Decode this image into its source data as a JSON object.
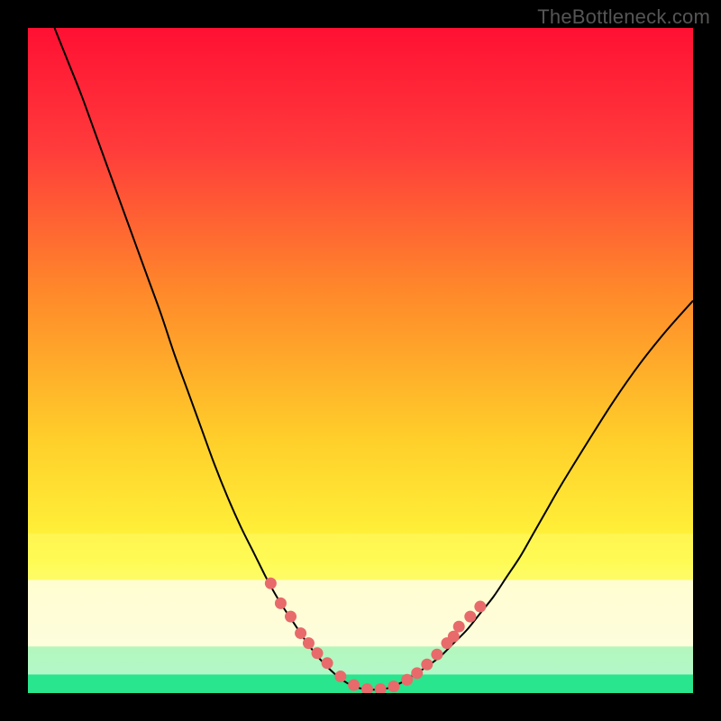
{
  "watermark": "TheBottleneck.com",
  "chart_data": {
    "type": "line",
    "title": "",
    "xlabel": "",
    "ylabel": "",
    "xlim": [
      0,
      100
    ],
    "ylim": [
      0,
      100
    ],
    "grid": false,
    "series": [
      {
        "name": "curve",
        "x": [
          4,
          6,
          8,
          10,
          12,
          14,
          16,
          18,
          20,
          22,
          24,
          26,
          28,
          30,
          32,
          34,
          36,
          38,
          40,
          42,
          44,
          46,
          48,
          50,
          52,
          54,
          56,
          58,
          60,
          62,
          64,
          66,
          68,
          70,
          72,
          74,
          76,
          78,
          80,
          84,
          88,
          92,
          96,
          100
        ],
        "y": [
          100,
          95,
          90,
          84.5,
          79,
          73.5,
          68,
          62.5,
          57,
          51,
          45.5,
          40,
          34.5,
          29.5,
          25,
          21,
          17,
          13.5,
          10.5,
          7.5,
          5,
          3,
          1.5,
          0.7,
          0.5,
          0.7,
          1.5,
          2.7,
          4,
          5.5,
          7.5,
          9.5,
          12,
          14.5,
          17.5,
          20.5,
          24,
          27.5,
          31,
          37.5,
          43.8,
          49.5,
          54.5,
          59
        ]
      }
    ],
    "markers": {
      "name": "dots",
      "color": "#e86a6a",
      "x": [
        36.5,
        38,
        39.5,
        41,
        42.2,
        43.5,
        45,
        47,
        49,
        51,
        53,
        55,
        57,
        58.5,
        60,
        61.5,
        63,
        64,
        64.8,
        66.5,
        68
      ],
      "y": [
        16.5,
        13.5,
        11.5,
        9,
        7.5,
        6,
        4.5,
        2.5,
        1.2,
        0.6,
        0.6,
        1,
        2,
        3,
        4.3,
        5.8,
        7.5,
        8.5,
        10,
        11.5,
        13
      ]
    },
    "bands": [
      {
        "name": "yellow-wash",
        "y0": 17,
        "y1": 24,
        "color": "#feff7d",
        "alpha": 0.35
      },
      {
        "name": "cream-band",
        "y0": 7,
        "y1": 17,
        "color": "#fffde0",
        "alpha": 0.88
      },
      {
        "name": "green-zone",
        "y0": 0,
        "y1": 2.8,
        "color": "#29e58d",
        "alpha": 1.0
      },
      {
        "name": "green-fade",
        "y0": 2.8,
        "y1": 7,
        "color": "#8af2bc",
        "alpha": 0.6
      }
    ],
    "gradient_stops": [
      {
        "offset": 0,
        "color": "#ff1033"
      },
      {
        "offset": 18,
        "color": "#ff3b3b"
      },
      {
        "offset": 40,
        "color": "#ff8a2a"
      },
      {
        "offset": 62,
        "color": "#ffcf2a"
      },
      {
        "offset": 80,
        "color": "#fff93d"
      },
      {
        "offset": 92,
        "color": "#f3ffb9"
      },
      {
        "offset": 100,
        "color": "#e9ffe9"
      }
    ]
  }
}
